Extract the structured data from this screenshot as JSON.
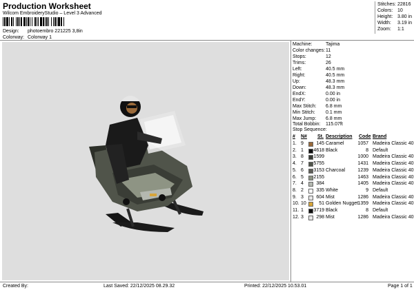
{
  "header": {
    "title": "Production Worksheet",
    "subtitle": "Wilcom EmbroideryStudio – Level 3 Advanced",
    "design_label": "Design:",
    "design_value": "photoembro 221225 3,8in",
    "colorway_label": "Colorway:",
    "colorway_value": "Colorway 1"
  },
  "stats": [
    {
      "label": "Stitches:",
      "value": "22816"
    },
    {
      "label": "Colors:",
      "value": "10"
    },
    {
      "label": "Height:",
      "value": "3.80 in"
    },
    {
      "label": "Width:",
      "value": "3.19 in"
    },
    {
      "label": "Zoom:",
      "value": "1:1"
    }
  ],
  "machine_info": [
    {
      "label": "Machine:",
      "value": "Tajima"
    },
    {
      "label": "Color changes:",
      "value": "11"
    },
    {
      "label": "Stops:",
      "value": "12"
    },
    {
      "label": "Trims:",
      "value": "26"
    },
    {
      "label": "Left:",
      "value": "40.5 mm"
    },
    {
      "label": "Right:",
      "value": "40.5 mm"
    },
    {
      "label": "Up:",
      "value": "48.3 mm"
    },
    {
      "label": "Down:",
      "value": "48.3 mm"
    },
    {
      "label": "EndX:",
      "value": "0.00 in"
    },
    {
      "label": "EndY:",
      "value": "0.00 in"
    },
    {
      "label": "Max Stitch:",
      "value": "6.8 mm"
    },
    {
      "label": "Min Stitch:",
      "value": "0.1 mm"
    },
    {
      "label": "Max Jump:",
      "value": "6.8 mm"
    },
    {
      "label": "Total Bobbin:",
      "value": "115.07ft"
    }
  ],
  "stop_sequence": {
    "title": "Stop Sequence:",
    "headers": {
      "num": "#",
      "n": "N#",
      "st": "St.",
      "description": "Description",
      "code": "Code",
      "brand": "Brand"
    },
    "rows": [
      {
        "num": "1.",
        "n": "9",
        "color": "#9a6a3a",
        "st": "145",
        "description": "Caramel",
        "code": "1057",
        "brand": "Madeira Classic 40"
      },
      {
        "num": "2.",
        "n": "1",
        "color": "#101010",
        "st": "4618",
        "description": "Black",
        "code": "8",
        "brand": "Default"
      },
      {
        "num": "3.",
        "n": "8",
        "color": "#3a3d36",
        "st": "1599",
        "description": "",
        "code": "1000",
        "brand": "Madeira Classic 40"
      },
      {
        "num": "4.",
        "n": "7",
        "color": "#50544a",
        "st": "5755",
        "description": "",
        "code": "1431",
        "brand": "Madeira Classic 40"
      },
      {
        "num": "5.",
        "n": "6",
        "color": "#5e5e58",
        "st": "3153",
        "description": "Charcoal",
        "code": "1239",
        "brand": "Madeira Classic 40"
      },
      {
        "num": "6.",
        "n": "5",
        "color": "#8e9484",
        "st": "2155",
        "description": "",
        "code": "1463",
        "brand": "Madeira Classic 40"
      },
      {
        "num": "7.",
        "n": "4",
        "color": "#b4b8b0",
        "st": "384",
        "description": "",
        "code": "1405",
        "brand": "Madeira Classic 40"
      },
      {
        "num": "8.",
        "n": "2",
        "color": "#ffffff",
        "st": "335",
        "description": "White",
        "code": "9",
        "brand": "Default"
      },
      {
        "num": "9.",
        "n": "3",
        "color": "#e6e6e6",
        "st": "604",
        "description": "Mist",
        "code": "1286",
        "brand": "Madeira Classic 40"
      },
      {
        "num": "10.",
        "n": "10",
        "color": "#d7a53a",
        "st": "51",
        "description": "Golden Nugget",
        "code": "1359",
        "brand": "Madeira Classic 40"
      },
      {
        "num": "11.",
        "n": "1",
        "color": "#101010",
        "st": "3719",
        "description": "Black",
        "code": "8",
        "brand": "Default"
      },
      {
        "num": "12.",
        "n": "3",
        "color": "#e6e6e6",
        "st": "298",
        "description": "Mist",
        "code": "1286",
        "brand": "Madeira Classic 40"
      }
    ]
  },
  "footer": {
    "created_by": "Created By:",
    "last_saved": "Last Saved: 22/12/2025 08.29.32",
    "printed": "Printed: 22/12/2025 10.53.01",
    "page": "Page 1 of 1"
  },
  "colors": {
    "design_bg": "#dedede",
    "rule": "#888888"
  }
}
